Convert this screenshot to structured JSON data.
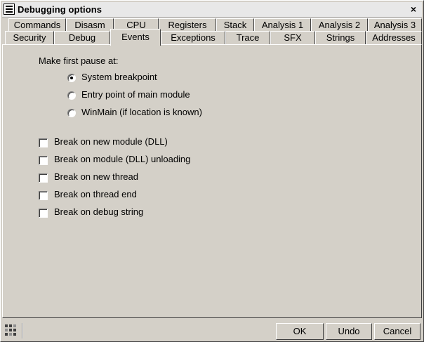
{
  "window": {
    "title": "Debugging options",
    "close_glyph": "×"
  },
  "tabs_row1": [
    {
      "label": "Commands"
    },
    {
      "label": "Disasm"
    },
    {
      "label": "CPU"
    },
    {
      "label": "Registers"
    },
    {
      "label": "Stack"
    },
    {
      "label": "Analysis 1"
    },
    {
      "label": "Analysis 2"
    },
    {
      "label": "Analysis 3"
    }
  ],
  "tabs_row2": [
    {
      "label": "Security"
    },
    {
      "label": "Debug"
    },
    {
      "label": "Events",
      "active": true
    },
    {
      "label": "Exceptions"
    },
    {
      "label": "Trace"
    },
    {
      "label": "SFX"
    },
    {
      "label": "Strings"
    },
    {
      "label": "Addresses"
    }
  ],
  "events": {
    "first_pause_label": "Make first pause at:",
    "radios": [
      {
        "label": "System breakpoint",
        "checked": true
      },
      {
        "label": "Entry point of main module",
        "checked": false
      },
      {
        "label": "WinMain (if location is known)",
        "checked": false
      }
    ],
    "checkboxes": [
      {
        "label": "Break on new module (DLL)",
        "checked": false
      },
      {
        "label": "Break on module (DLL) unloading",
        "checked": false
      },
      {
        "label": "Break on new thread",
        "checked": false
      },
      {
        "label": "Break on thread end",
        "checked": false
      },
      {
        "label": "Break on debug string",
        "checked": false
      }
    ]
  },
  "buttons": {
    "ok": "OK",
    "undo": "Undo",
    "cancel": "Cancel"
  },
  "icons": {
    "title": "list-icon",
    "status": "grid-icon"
  }
}
